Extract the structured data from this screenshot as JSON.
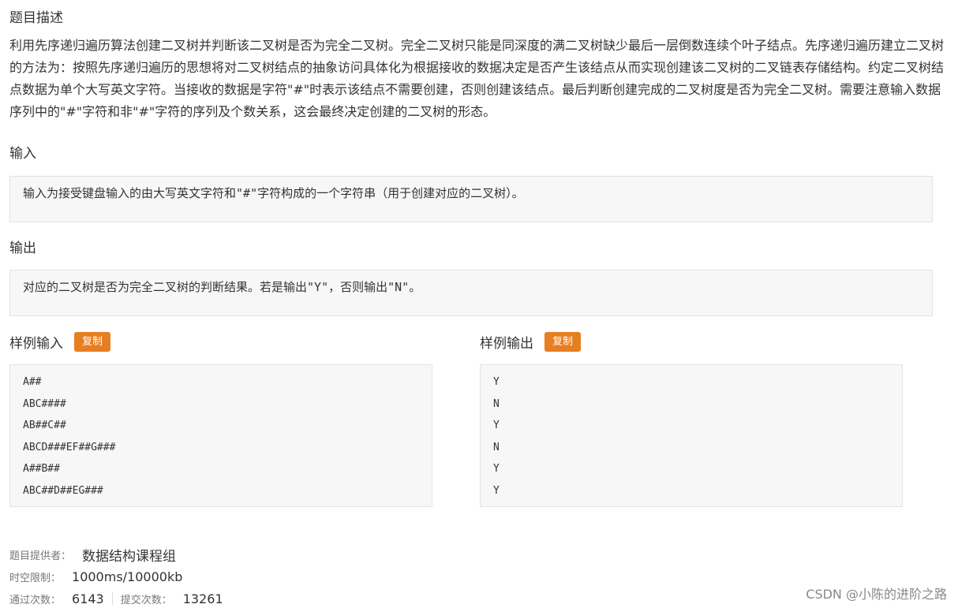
{
  "problem": {
    "description_title": "题目描述",
    "description": "利用先序递归遍历算法创建二叉树并判断该二叉树是否为完全二叉树。完全二叉树只能是同深度的满二叉树缺少最后一层倒数连续个叶子结点。先序递归遍历建立二叉树的方法为：按照先序递归遍历的思想将对二叉树结点的抽象访问具体化为根据接收的数据决定是否产生该结点从而实现创建该二叉树的二叉链表存储结构。约定二叉树结点数据为单个大写英文字符。当接收的数据是字符\"#\"时表示该结点不需要创建，否则创建该结点。最后判断创建完成的二叉树度是否为完全二叉树。需要注意输入数据序列中的\"#\"字符和非\"#\"字符的序列及个数关系，这会最终决定创建的二叉树的形态。",
    "input_title": "输入",
    "input_text": "输入为接受键盘输入的由大写英文字符和\"#\"字符构成的一个字符串（用于创建对应的二叉树）。",
    "output_title": "输出",
    "output_text": "对应的二叉树是否为完全二叉树的判断结果。若是输出\"Y\"，否则输出\"N\"。"
  },
  "samples": {
    "input_label": "样例输入",
    "output_label": "样例输出",
    "copy_label": "复制",
    "input_lines": [
      "A##",
      "ABC####",
      "AB##C##",
      "ABCD###EF##G###",
      "A##B##",
      "ABC##D##EG###"
    ],
    "output_lines": [
      "Y",
      "N",
      "Y",
      "N",
      "Y",
      "Y"
    ]
  },
  "meta": {
    "provider_label": "题目提供者：",
    "provider_value": "数据结构课程组",
    "limit_label": "时空限制：",
    "limit_value": "1000ms/10000kb",
    "pass_label": "通过次数：",
    "pass_value": "6143",
    "submit_label": "提交次数：",
    "submit_value": "13261"
  },
  "watermark": "CSDN @小陈的进阶之路",
  "colors": {
    "accent": "#e67e22",
    "box_bg": "#f7f7f7",
    "box_border": "#e3e3e3"
  }
}
